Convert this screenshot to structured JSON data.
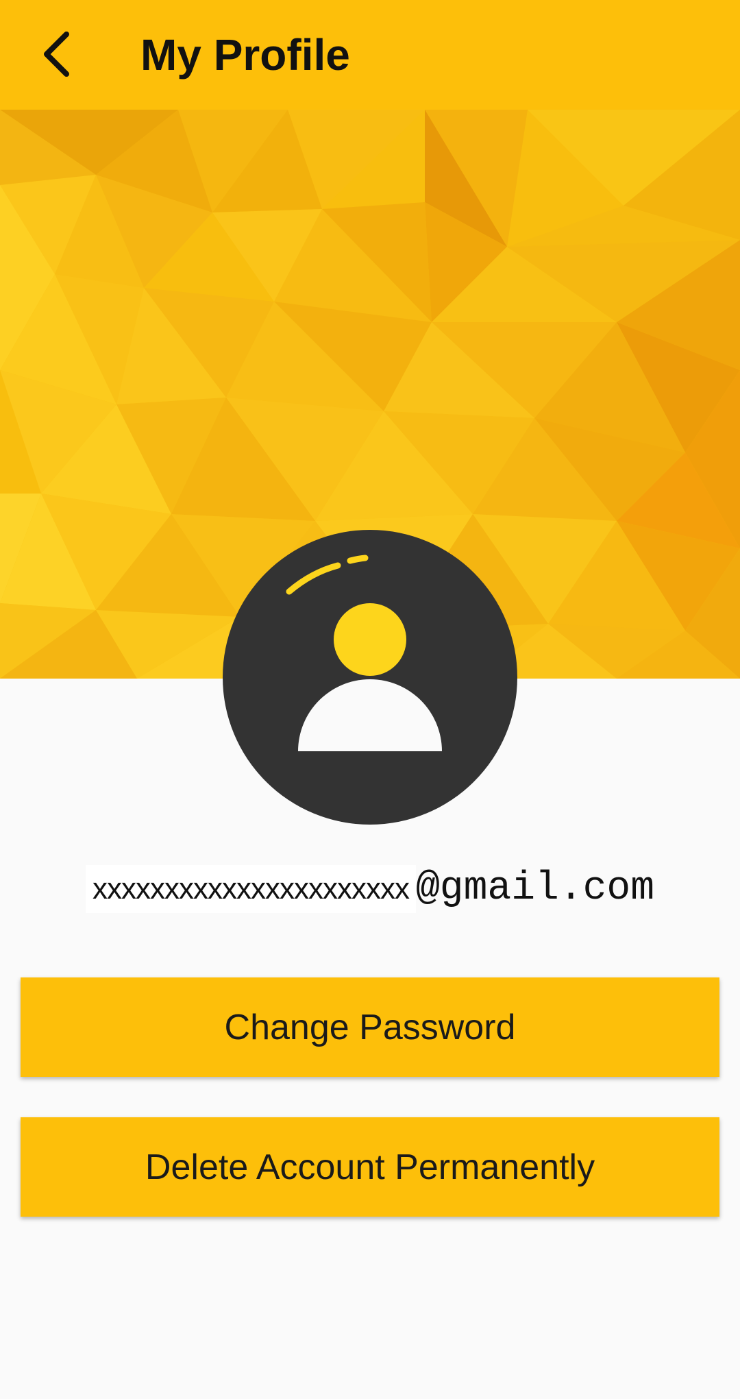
{
  "header": {
    "back_icon": "chevron-left-icon",
    "title": "My Profile"
  },
  "colors": {
    "accent": "#fdbf0a",
    "avatar_background": "#333333",
    "avatar_head": "#fdd51c",
    "page_background": "#fafafa"
  },
  "banner": {
    "pattern": "yellow low-poly triangles"
  },
  "avatar": {
    "icon": "user-avatar-icon"
  },
  "profile": {
    "email_local": "xxxxxxxxxxxxxxxxxxxxxx",
    "email_domain": "@gmail.com"
  },
  "actions": {
    "change_password": "Change Password",
    "delete_account": "Delete Account Permanently"
  }
}
